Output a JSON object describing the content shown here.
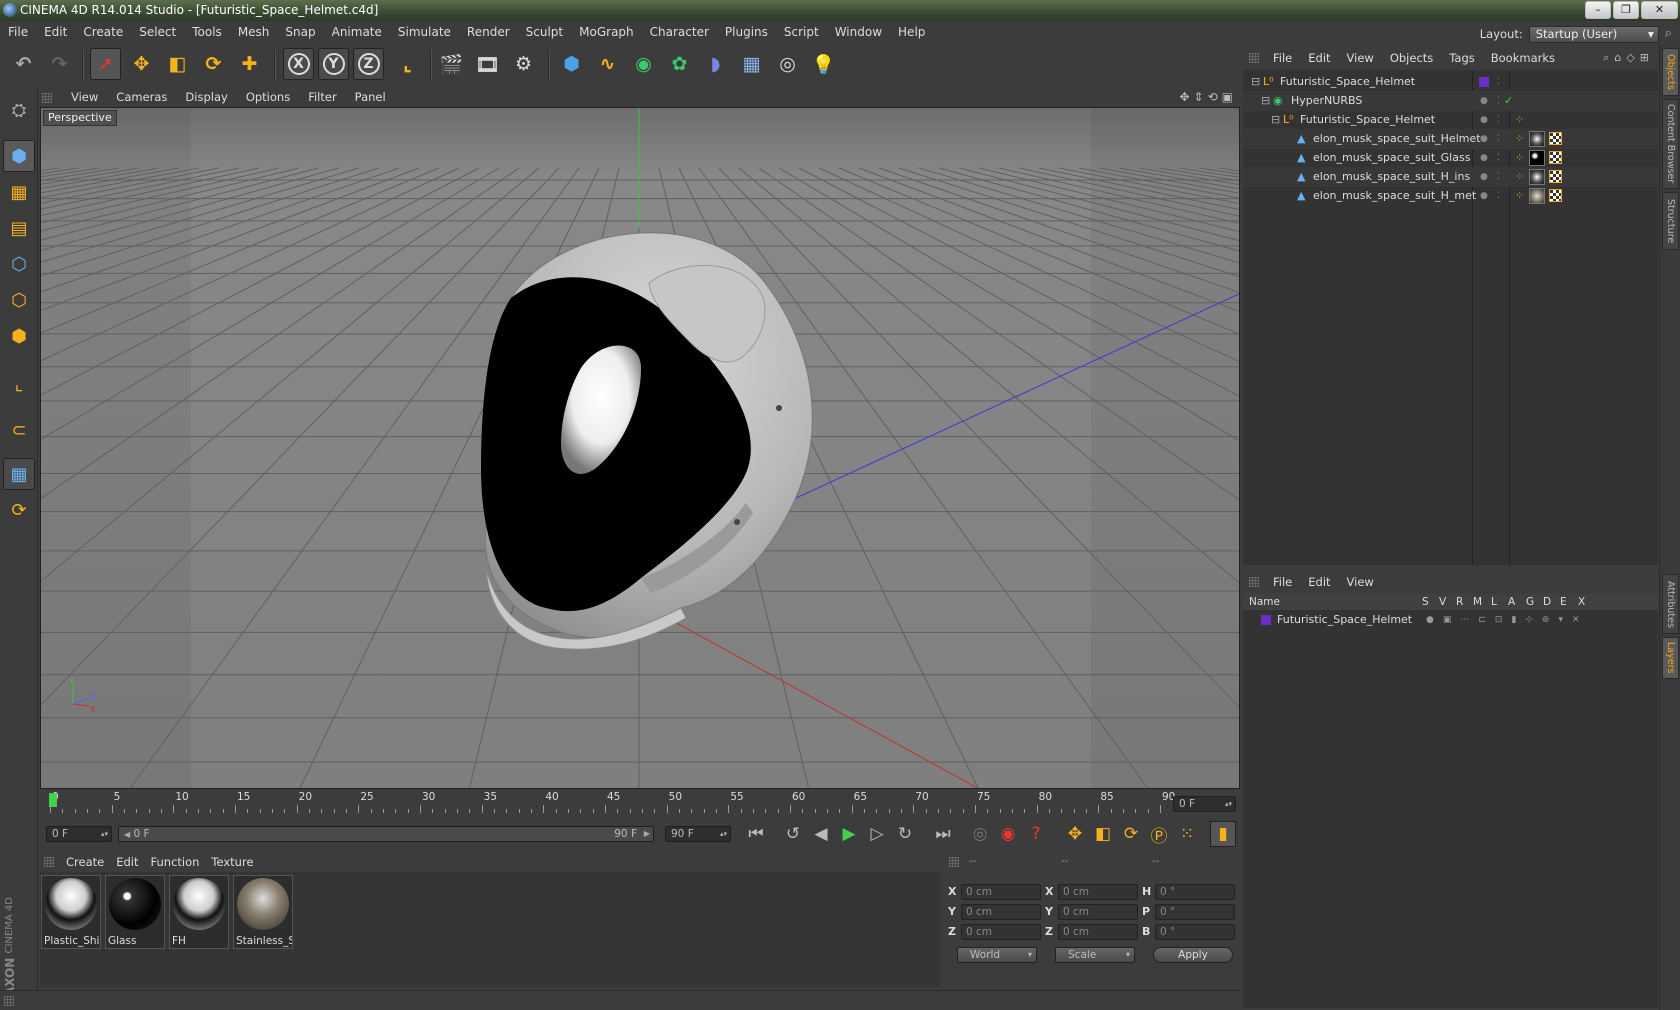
{
  "window": {
    "title": "CINEMA 4D R14.014 Studio - [Futuristic_Space_Helmet.c4d]",
    "controls": [
      "–",
      "❐",
      "✕"
    ]
  },
  "menubar": [
    "File",
    "Edit",
    "Create",
    "Select",
    "Tools",
    "Mesh",
    "Snap",
    "Animate",
    "Simulate",
    "Render",
    "Sculpt",
    "MoGraph",
    "Character",
    "Plugins",
    "Script",
    "Window",
    "Help"
  ],
  "layout": {
    "label": "Layout:",
    "value": "Startup (User)"
  },
  "toolbar": {
    "icons": [
      "undo-icon",
      "redo-icon",
      "live-selection-icon",
      "move-icon",
      "scale-icon",
      "rotate-icon",
      "add-icon",
      "x-axis-icon",
      "y-axis-icon",
      "z-axis-icon",
      "coordinate-system-icon",
      "render-view-icon",
      "render-picture-viewer-icon",
      "edit-render-settings-icon",
      "cube-icon",
      "spline-icon",
      "nurbs-icon",
      "array-icon",
      "deformer-icon",
      "floor-icon",
      "camera-icon",
      "light-icon"
    ],
    "axis_labels": [
      "X",
      "Y",
      "Z"
    ]
  },
  "viewport": {
    "menu": [
      "View",
      "Cameras",
      "Display",
      "Options",
      "Filter",
      "Panel"
    ],
    "label": "Perspective",
    "axis_labels": {
      "y": "Y",
      "z": "Z",
      "x": "X"
    }
  },
  "timeline": {
    "ticks": [
      "0",
      "5",
      "10",
      "15",
      "20",
      "25",
      "30",
      "35",
      "40",
      "45",
      "50",
      "55",
      "60",
      "65",
      "70",
      "75",
      "80",
      "85",
      "90"
    ],
    "current_frame": "0 F"
  },
  "transport": {
    "start": "0 F",
    "range_start": "0 F",
    "range_end": "90 F",
    "end": "90 F"
  },
  "materials": {
    "menu": [
      "Create",
      "Edit",
      "Function",
      "Texture"
    ],
    "items": [
      {
        "name": "Plastic_Shir",
        "style": "helmet"
      },
      {
        "name": "Glass",
        "style": "glass"
      },
      {
        "name": "FH",
        "style": "helmet"
      },
      {
        "name": "Stainless_S",
        "style": "steel"
      }
    ]
  },
  "coordinates": {
    "headers": [
      "--",
      "--",
      "--"
    ],
    "rows": [
      {
        "l1": "X",
        "v1": "0 cm",
        "l2": "X",
        "v2": "0 cm",
        "l3": "H",
        "v3": "0 °"
      },
      {
        "l1": "Y",
        "v1": "0 cm",
        "l2": "Y",
        "v2": "0 cm",
        "l3": "P",
        "v3": "0 °"
      },
      {
        "l1": "Z",
        "v1": "0 cm",
        "l2": "Z",
        "v2": "0 cm",
        "l3": "B",
        "v3": "0 °"
      }
    ],
    "mode": "World",
    "size_mode": "Scale",
    "apply": "Apply"
  },
  "objects": {
    "menu": [
      "File",
      "Edit",
      "View",
      "Objects",
      "Tags",
      "Bookmarks"
    ],
    "items": [
      {
        "name": "Futuristic_Space_Helmet",
        "indent": 0,
        "icon": "null-object-icon"
      },
      {
        "name": "HyperNURBS",
        "indent": 1,
        "icon": "hypernurbs-icon"
      },
      {
        "name": "Futuristic_Space_Helmet",
        "indent": 2,
        "icon": "null-object-icon"
      },
      {
        "name": "elon_musk_space_suit_Helmet",
        "indent": 3,
        "icon": "polygon-object-icon"
      },
      {
        "name": "elon_musk_space_suit_Glass",
        "indent": 3,
        "icon": "polygon-object-icon"
      },
      {
        "name": "elon_musk_space_suit_H_ins",
        "indent": 3,
        "icon": "polygon-object-icon"
      },
      {
        "name": "elon_musk_space_suit_H_met",
        "indent": 3,
        "icon": "polygon-object-icon"
      }
    ]
  },
  "layers": {
    "menu": [
      "File",
      "Edit",
      "View"
    ],
    "columns": [
      "Name",
      "S",
      "V",
      "R",
      "M",
      "L",
      "A",
      "G",
      "D",
      "E",
      "X"
    ],
    "items": [
      {
        "name": "Futuristic_Space_Helmet",
        "color": "#6a2fc7"
      }
    ]
  },
  "side_tabs": [
    "Objects",
    "Content Browser",
    "Structure",
    "Attributes",
    "Layers"
  ],
  "brand": {
    "line1": "MAXON",
    "line2": "CINEMA 4D"
  },
  "colors": {
    "accent": "#f5a623",
    "layer": "#6a2fc7",
    "play": "#3fd24a"
  }
}
